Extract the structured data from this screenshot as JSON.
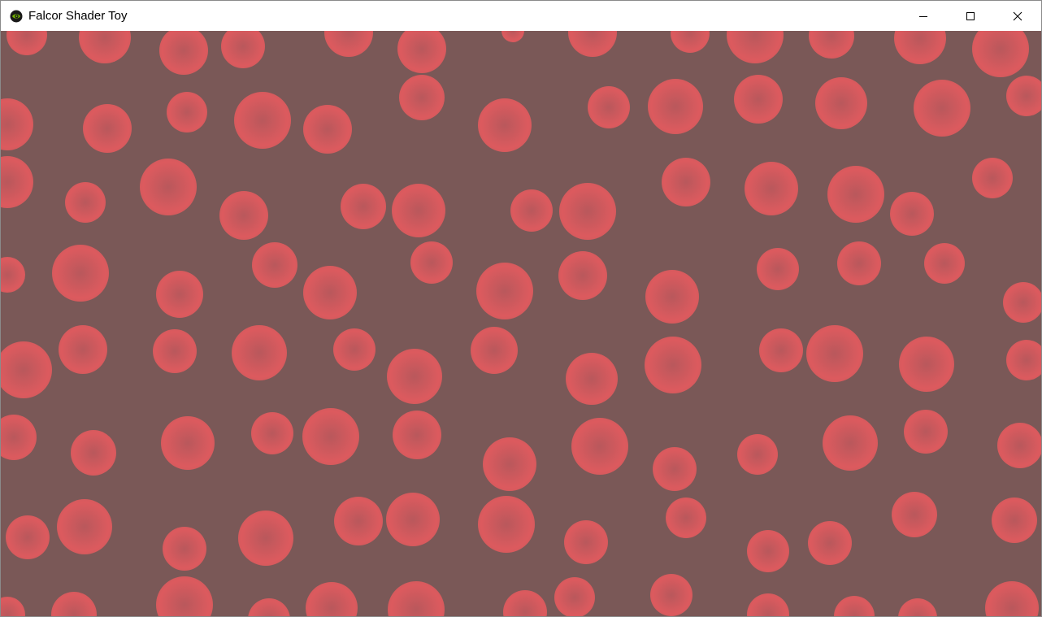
{
  "window": {
    "title": "Falcor Shader Toy",
    "icon": "nvidia-eye-icon",
    "controls": {
      "minimize": "minimize-icon",
      "maximize": "maximize-icon",
      "close": "close-icon"
    }
  },
  "render": {
    "background_color": "#7a5857",
    "circle_edge_color": "#dc5a5e",
    "circle_center_color": "#b9585c"
  }
}
